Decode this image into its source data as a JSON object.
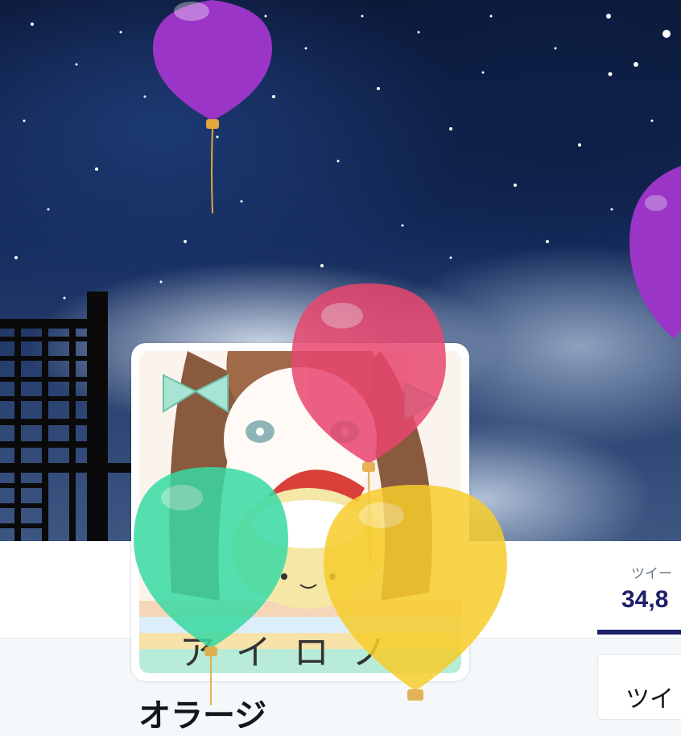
{
  "profile": {
    "header_image": "night-sky-header",
    "avatar_image": "anime-girl-avatar",
    "avatar_caption": "アイロノ",
    "name": "オラージ"
  },
  "stats": {
    "tweets_label": "ツイー",
    "tweets_value": "34,8"
  },
  "timeline": {
    "tab_label": "ツイ"
  },
  "balloons": [
    "purple",
    "magenta",
    "green",
    "yellow",
    "purple"
  ],
  "colors": {
    "accent": "#1c2068",
    "balloon_purple": "#9b35c8",
    "balloon_pink": "#e8466e",
    "balloon_green": "#37d9a3",
    "balloon_yellow": "#f7cd2c"
  }
}
